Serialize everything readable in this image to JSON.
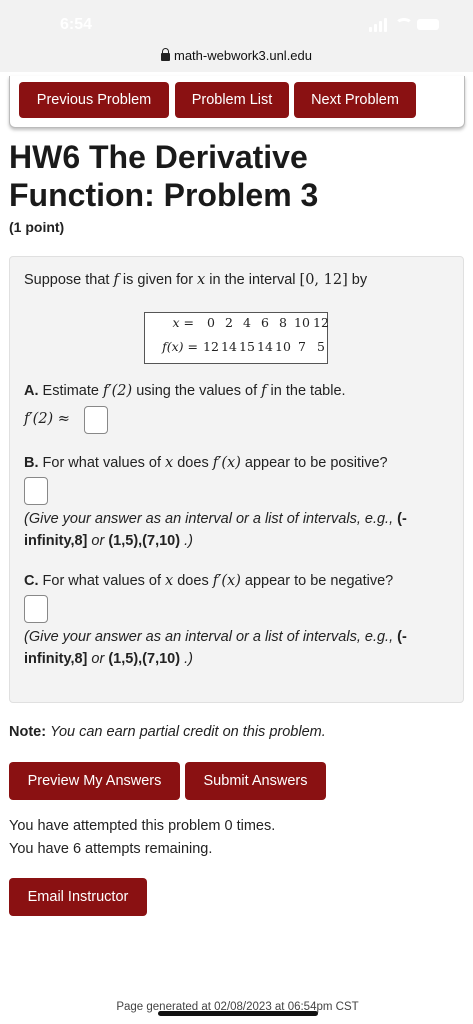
{
  "status": {
    "time": "6:54"
  },
  "browser": {
    "url": "math-webwork3.unl.edu"
  },
  "nav": {
    "previous": "Previous Problem",
    "list": "Problem List",
    "next": "Next Problem"
  },
  "title": "HW6 The Derivative Function: Problem 3",
  "points": "(1 point)",
  "problem": {
    "intro_pre": "Suppose that ",
    "intro_f": "f",
    "intro_mid": " is given for ",
    "intro_x": "x",
    "intro_mid2": " in the interval ",
    "interval": "[0, 12]",
    "intro_post": " by",
    "table": {
      "x_label": "x =",
      "fx_label": "f(x) =",
      "x_values": [
        "0",
        "2",
        "4",
        "6",
        "8",
        "10",
        "12"
      ],
      "f_values": [
        "12",
        "14",
        "15",
        "14",
        "10",
        "7",
        "5"
      ]
    },
    "part_a": {
      "letter": "A.",
      "text_pre": " Estimate ",
      "expr": "f′(2)",
      "text_post": " using the values of ",
      "f": "f",
      "text_end": " in the table.",
      "answer_label": "f′(2) ≈"
    },
    "part_b": {
      "letter": "B.",
      "text_pre": " For what values of ",
      "x": "x",
      "text_mid": " does ",
      "expr": "f′(x)",
      "text_post": " appear to be positive?"
    },
    "part_c": {
      "letter": "C.",
      "text_pre": " For what values of ",
      "x": "x",
      "text_mid": " does ",
      "expr": "f′(x)",
      "text_post": " appear to be negative?"
    },
    "hint_pre": "(Give your answer as an interval or a list of intervals, e.g., ",
    "hint_ex1": "(-infinity,8]",
    "hint_or": " or ",
    "hint_ex2": "(1,5),(7,10)",
    "hint_end": " .)"
  },
  "note": {
    "label": "Note:",
    "text": "You can earn partial credit on this problem."
  },
  "actions": {
    "preview": "Preview My Answers",
    "submit": "Submit Answers"
  },
  "attempts": {
    "line1": "You have attempted this problem 0 times.",
    "line2": "You have 6 attempts remaining."
  },
  "email": "Email Instructor",
  "footer": "Page generated at 02/08/2023 at 06:54pm CST"
}
